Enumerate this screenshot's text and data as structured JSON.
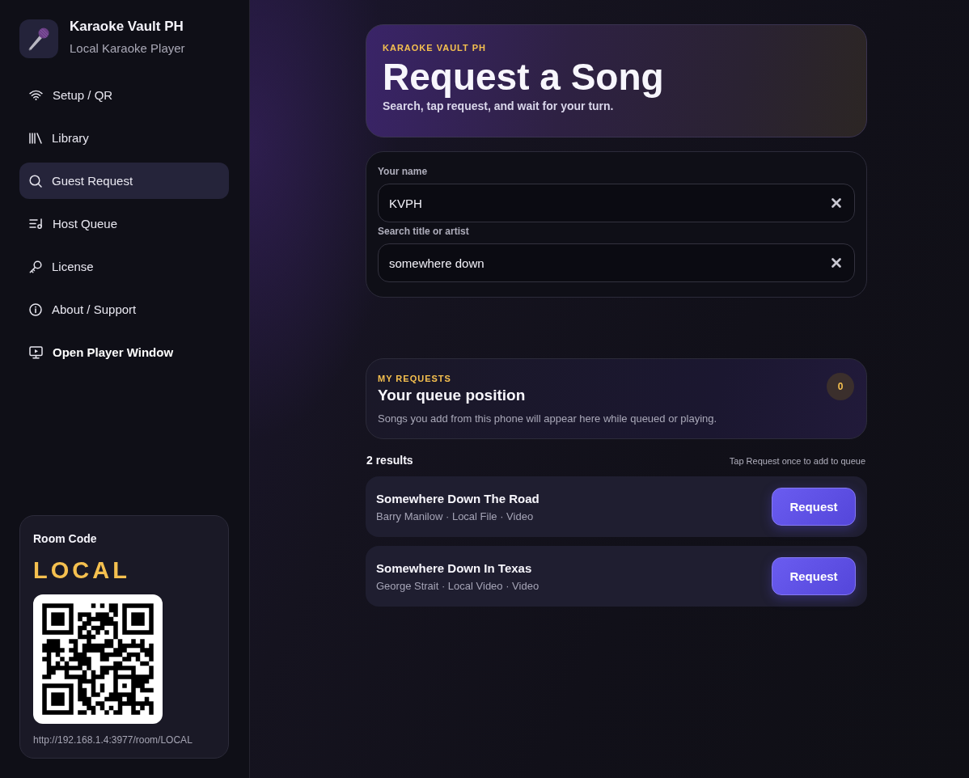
{
  "sidebar": {
    "brand": {
      "title": "Karaoke Vault PH",
      "subtitle": "Local Karaoke Player"
    },
    "nav": [
      {
        "label": "Setup / QR",
        "kind": "page",
        "selected": false
      },
      {
        "label": "Library",
        "kind": "page",
        "selected": false
      },
      {
        "label": "Guest Request",
        "kind": "page",
        "selected": true
      },
      {
        "label": "Host Queue",
        "kind": "page",
        "selected": false
      },
      {
        "label": "License",
        "kind": "page",
        "selected": false
      },
      {
        "label": "About / Support",
        "kind": "page",
        "selected": false
      },
      {
        "label": "Open Player Window",
        "kind": "action",
        "selected": false
      }
    ],
    "room": {
      "heading": "Room Code",
      "code": "LOCAL",
      "url": "http://192.168.1.4:3977/room/LOCAL"
    }
  },
  "header": {
    "eyebrow": "KARAOKE VAULT PH",
    "title": "Request a Song",
    "subtitle": "Search, tap request, and wait for your turn."
  },
  "form": {
    "fields": [
      {
        "label": "Your name",
        "value": "KVPH"
      },
      {
        "label": "Search title or artist",
        "value": "somewhere down"
      }
    ]
  },
  "my_requests": {
    "eyebrow": "MY REQUESTS",
    "title": "Your queue position",
    "description": "Songs you add from this phone will appear here while queued or playing.",
    "count": "0"
  },
  "results": {
    "count": "2 results",
    "hint": "Tap Request once to add to queue",
    "items": [
      {
        "title": "Somewhere Down The Road",
        "meta": "Barry Manilow · Local File · Video",
        "action": "Request"
      },
      {
        "title": "Somewhere Down In Texas",
        "meta": "George Strait · Local Video · Video",
        "action": "Request"
      }
    ]
  }
}
